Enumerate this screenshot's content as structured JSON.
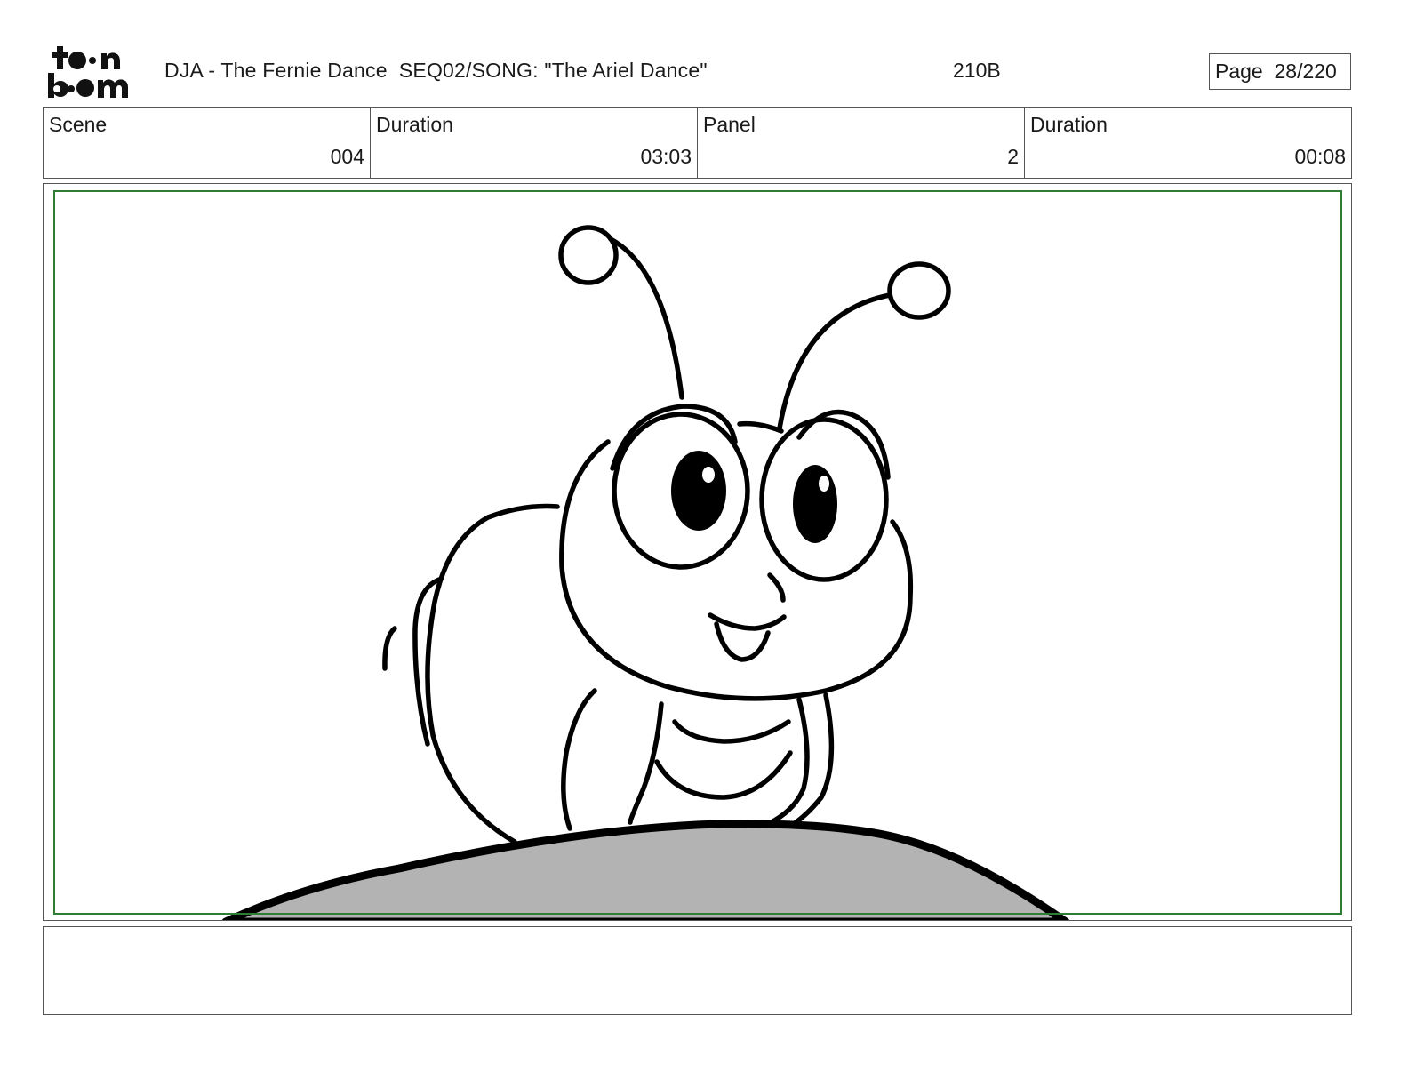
{
  "header": {
    "logo_text": "toon boom",
    "title": "DJA - The Fernie Dance  SEQ02/SONG: \"The Ariel Dance\"",
    "code": "210B",
    "page_label": "Page",
    "page_number": "28/220"
  },
  "info": {
    "scene_label": "Scene",
    "scene_value": "004",
    "scene_duration_label": "Duration",
    "scene_duration_value": "03:03",
    "panel_label": "Panel",
    "panel_value": "2",
    "panel_duration_label": "Duration",
    "panel_duration_value": "00:08"
  },
  "colors": {
    "safe_area": "#2e7d32",
    "ground_fill": "#b3b3b3",
    "ink": "#000000"
  },
  "notes": {
    "text": ""
  }
}
